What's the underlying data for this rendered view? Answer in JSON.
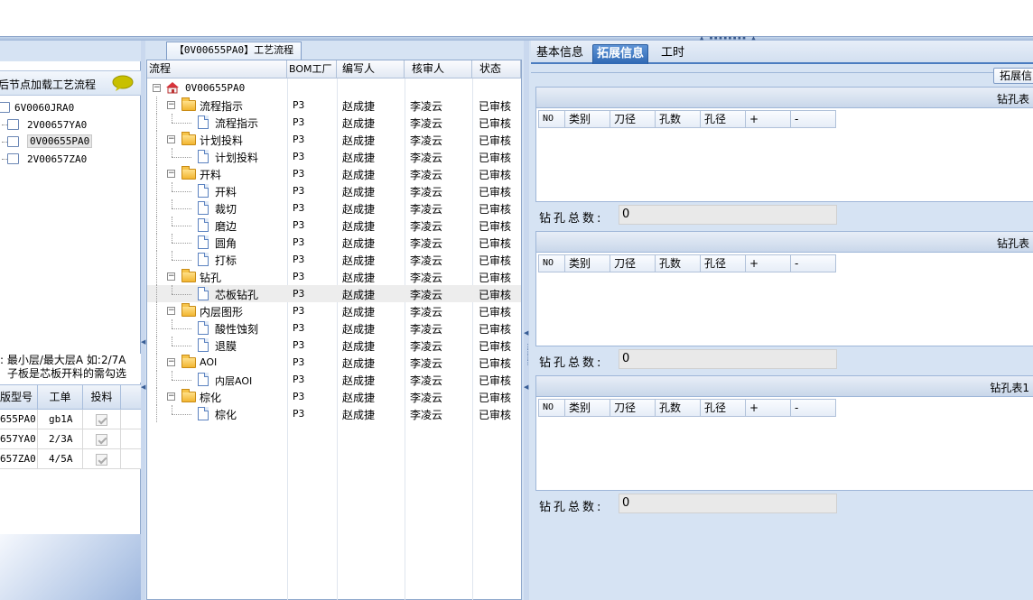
{
  "top_grip": "▲ ▪▪▪▪▪▪▪▪ ▲",
  "left": {
    "header_title": "后节点加载工艺流程",
    "tree": [
      {
        "label": "6V0060JRA0",
        "level": 0,
        "selected": false
      },
      {
        "label": "2V00657YA0",
        "level": 1,
        "selected": false
      },
      {
        "label": "0V00655PA0",
        "level": 1,
        "selected": true
      },
      {
        "label": "2V00657ZA0",
        "level": 1,
        "selected": false
      }
    ],
    "note_line1": ": 最小层/最大层A 如:2/7A",
    "note_line2": "子板是芯板开料的需勾选",
    "grid_headers": [
      "版型号",
      "工单",
      "投料"
    ],
    "grid_rows": [
      {
        "model": "655PA0",
        "order": "gb1A",
        "checked": true
      },
      {
        "model": "657YA0",
        "order": "2/3A",
        "checked": true
      },
      {
        "model": "657ZA0",
        "order": "4/5A",
        "checked": true
      }
    ]
  },
  "middle": {
    "tab_label": "【0V00655PA0】工艺流程",
    "headers": {
      "flow": "流程",
      "bom": "BOM工厂",
      "writer": "编写人",
      "reviewer": "核审人",
      "status": "状态"
    },
    "rows": [
      {
        "name": "0V00655PA0",
        "type": "root",
        "bom": "",
        "writer": "",
        "reviewer": "",
        "status": ""
      },
      {
        "name": "流程指示",
        "type": "folder",
        "bom": "P3",
        "writer": "赵成捷",
        "reviewer": "李凌云",
        "status": "已审核"
      },
      {
        "name": "流程指示",
        "type": "doc",
        "bom": "P3",
        "writer": "赵成捷",
        "reviewer": "李凌云",
        "status": "已审核"
      },
      {
        "name": "计划投料",
        "type": "folder",
        "bom": "P3",
        "writer": "赵成捷",
        "reviewer": "李凌云",
        "status": "已审核"
      },
      {
        "name": "计划投料",
        "type": "doc",
        "bom": "P3",
        "writer": "赵成捷",
        "reviewer": "李凌云",
        "status": "已审核"
      },
      {
        "name": "开料",
        "type": "folder",
        "bom": "P3",
        "writer": "赵成捷",
        "reviewer": "李凌云",
        "status": "已审核"
      },
      {
        "name": "开料",
        "type": "doc",
        "bom": "P3",
        "writer": "赵成捷",
        "reviewer": "李凌云",
        "status": "已审核"
      },
      {
        "name": "裁切",
        "type": "doc",
        "bom": "P3",
        "writer": "赵成捷",
        "reviewer": "李凌云",
        "status": "已审核"
      },
      {
        "name": "磨边",
        "type": "doc",
        "bom": "P3",
        "writer": "赵成捷",
        "reviewer": "李凌云",
        "status": "已审核"
      },
      {
        "name": "圆角",
        "type": "doc",
        "bom": "P3",
        "writer": "赵成捷",
        "reviewer": "李凌云",
        "status": "已审核"
      },
      {
        "name": "打标",
        "type": "doc",
        "bom": "P3",
        "writer": "赵成捷",
        "reviewer": "李凌云",
        "status": "已审核"
      },
      {
        "name": "钻孔",
        "type": "folder",
        "bom": "P3",
        "writer": "赵成捷",
        "reviewer": "李凌云",
        "status": "已审核"
      },
      {
        "name": "芯板钻孔",
        "type": "doc",
        "bom": "P3",
        "writer": "赵成捷",
        "reviewer": "李凌云",
        "status": "已审核",
        "selected": true
      },
      {
        "name": "内层图形",
        "type": "folder",
        "bom": "P3",
        "writer": "赵成捷",
        "reviewer": "李凌云",
        "status": "已审核"
      },
      {
        "name": "酸性蚀刻",
        "type": "doc",
        "bom": "P3",
        "writer": "赵成捷",
        "reviewer": "李凌云",
        "status": "已审核"
      },
      {
        "name": "退膜",
        "type": "doc",
        "bom": "P3",
        "writer": "赵成捷",
        "reviewer": "李凌云",
        "status": "已审核"
      },
      {
        "name": "AOI",
        "type": "folder",
        "bom": "P3",
        "writer": "赵成捷",
        "reviewer": "李凌云",
        "status": "已审核"
      },
      {
        "name": "内层AOI",
        "type": "doc",
        "bom": "P3",
        "writer": "赵成捷",
        "reviewer": "李凌云",
        "status": "已审核"
      },
      {
        "name": "棕化",
        "type": "folder",
        "bom": "P3",
        "writer": "赵成捷",
        "reviewer": "李凌云",
        "status": "已审核"
      },
      {
        "name": "棕化",
        "type": "doc",
        "bom": "P3",
        "writer": "赵成捷",
        "reviewer": "李凌云",
        "status": "已审核"
      }
    ]
  },
  "right": {
    "tabs": [
      {
        "label": "基本信息",
        "active": false
      },
      {
        "label": "拓展信息",
        "active": true
      },
      {
        "label": "工时",
        "active": false
      }
    ],
    "ext_button": "拓展信",
    "drill_tables": [
      {
        "title": "钻孔表",
        "total_label": "钻孔总数:",
        "total_value": "0"
      },
      {
        "title": "钻孔表",
        "total_label": "钻孔总数:",
        "total_value": "0"
      },
      {
        "title": "钻孔表1",
        "total_label": "钻孔总数:",
        "total_value": "0"
      }
    ],
    "drill_columns": [
      "NO",
      "类别",
      "刀径",
      "孔数",
      "孔径",
      "+",
      "-"
    ]
  },
  "colors": {
    "accent": "#2f68b3",
    "panel_bg": "#d6e3f3",
    "border": "#8fa8cc"
  }
}
